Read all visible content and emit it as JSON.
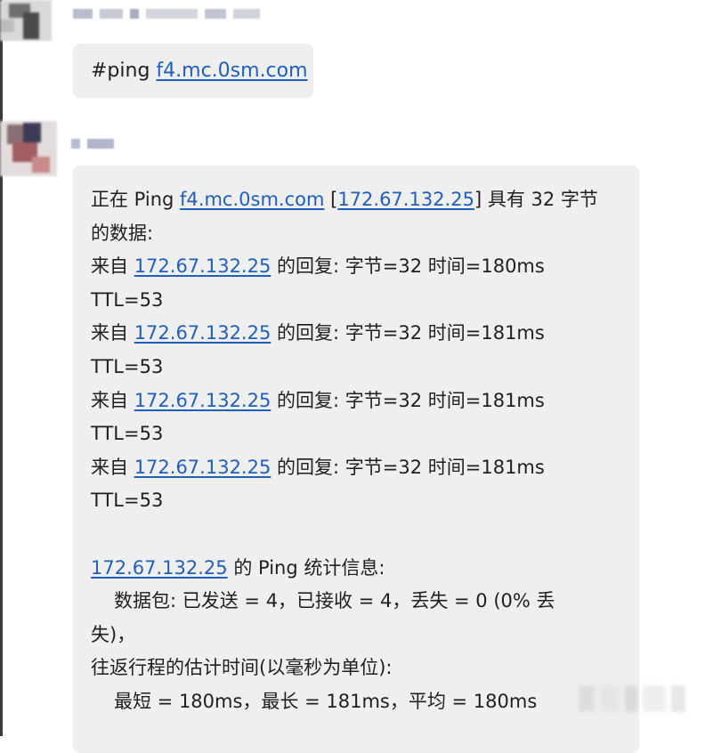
{
  "messages": [
    {
      "text_prefix": "#ping ",
      "link": "f4.mc.0sm.com"
    },
    {
      "header": {
        "p1": "正在 Ping ",
        "host": "f4.mc.0sm.com",
        "p2": " [",
        "ip": "172.67.132.25",
        "p3": "] 具有 32 字节",
        "cont": "的数据:"
      },
      "replies": [
        {
          "prefix": "来自 ",
          "ip": "172.67.132.25",
          "rest": " 的回复: 字节=32 时间=180ms",
          "ttl": "TTL=53"
        },
        {
          "prefix": "来自 ",
          "ip": "172.67.132.25",
          "rest": " 的回复: 字节=32 时间=181ms",
          "ttl": "TTL=53"
        },
        {
          "prefix": "来自 ",
          "ip": "172.67.132.25",
          "rest": " 的回复: 字节=32 时间=181ms",
          "ttl": "TTL=53"
        },
        {
          "prefix": "来自 ",
          "ip": "172.67.132.25",
          "rest": " 的回复: 字节=32 时间=181ms",
          "ttl": "TTL=53"
        }
      ],
      "stats": {
        "ip": "172.67.132.25",
        "title_rest": " 的 Ping 统计信息:",
        "packets": "数据包: 已发送 = 4，已接收 = 4，丢失 = 0 (0% 丢",
        "packets_cont": "失)，",
        "rtt_title": "往返行程的估计时间(以毫秒为单位):",
        "rtt": "最短 = 180ms，最长 = 181ms，平均 = 180ms"
      }
    }
  ],
  "colors": {
    "bubble": "#efefef",
    "link": "#1f5fbf"
  }
}
